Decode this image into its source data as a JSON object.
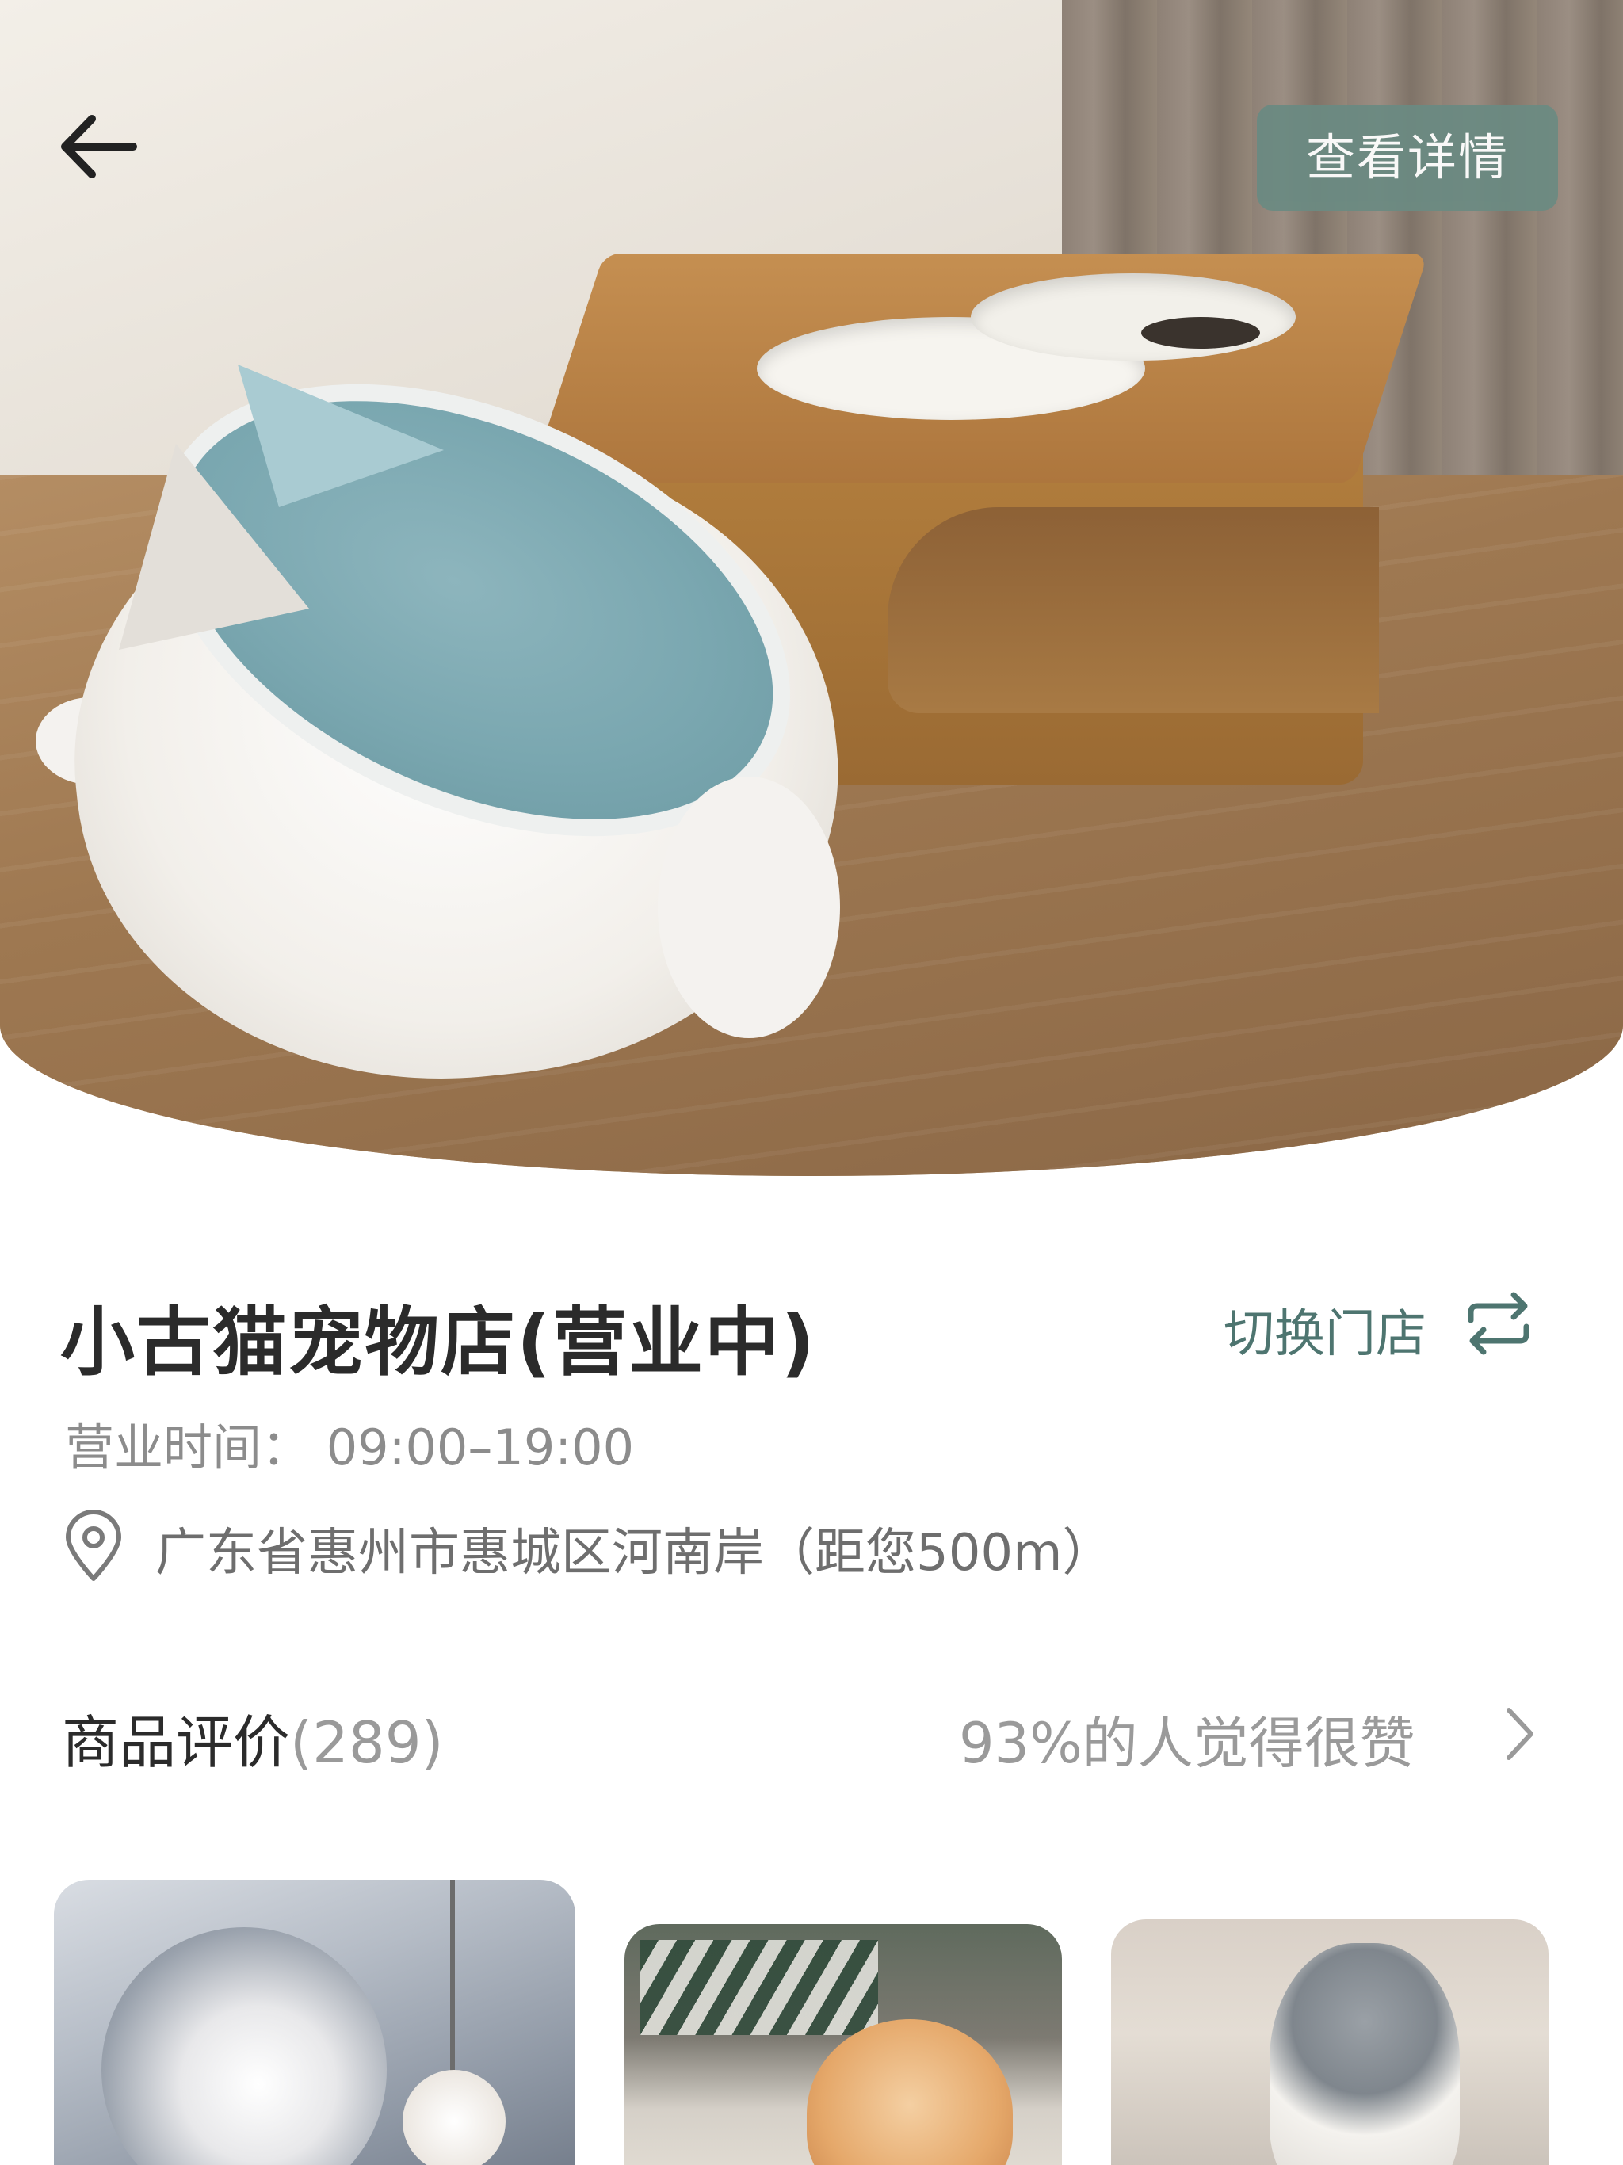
{
  "header": {
    "back_icon": "arrow-left-icon",
    "detail_button": "查看详情"
  },
  "store": {
    "name": "小古猫宠物店(营业中)",
    "switch_label": "切换门店",
    "switch_icon": "swap-icon",
    "hours": "营业时间：  09:00–19:00",
    "location_icon": "map-pin-icon",
    "address": "广东省惠州市惠城区河南岸（距您500m）"
  },
  "reviews": {
    "title": "商品评价",
    "count": "(289)",
    "rating_text": "93%的人觉得很赞",
    "chevron_icon": "chevron-right-icon"
  },
  "colors": {
    "accent": "#4e7570",
    "button_bg": "#6b8a82",
    "title_text": "#2b2b2b",
    "secondary_text": "#8c8c8c"
  }
}
